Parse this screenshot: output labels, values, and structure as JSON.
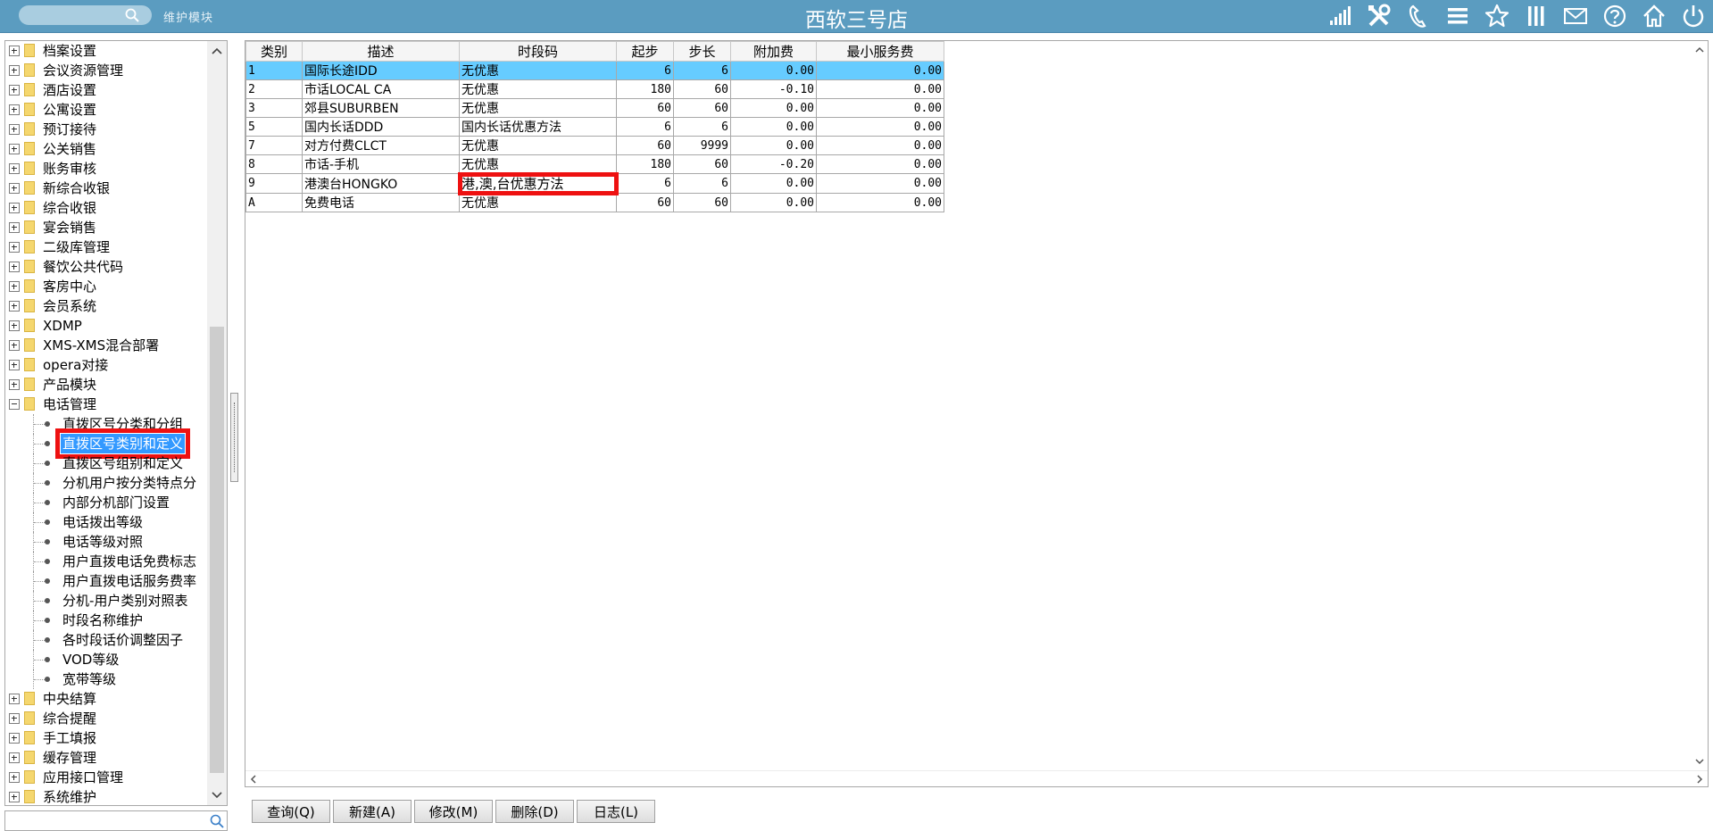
{
  "header": {
    "module_label": "维护模块",
    "title": "西软三号店",
    "toolbar_icons": [
      "signal-icon",
      "tools-icon",
      "phone-icon",
      "menu-icon",
      "star-icon",
      "columns-icon",
      "mail-icon",
      "help-icon",
      "home-icon",
      "power-icon"
    ]
  },
  "tree": {
    "top_items": [
      "档案设置",
      "会议资源管理",
      "酒店设置",
      "公寓设置",
      "预订接待",
      "公关销售",
      "账务审核",
      "新综合收银",
      "综合收银",
      "宴会销售",
      "二级库管理",
      "餐饮公共代码",
      "客房中心",
      "会员系统",
      "XDMP",
      "XMS-XMS混合部署",
      "opera对接",
      "产品模块"
    ],
    "expanded_item": "电话管理",
    "children": [
      "直拨区号分类和分组",
      "直拨区号类别和定义",
      "直拨区号组别和定义",
      "分机用户按分类特点分",
      "内部分机部门设置",
      "电话拨出等级",
      "电话等级对照",
      "用户直拨电话免费标志",
      "用户直拨电话服务费率",
      "分机-用户类别对照表",
      "时段名称维护",
      "各时段话价调整因子",
      "VOD等级",
      "宽带等级"
    ],
    "selected_child_index": 1,
    "bottom_items": [
      "中央结算",
      "综合提醒",
      "手工填报",
      "缓存管理",
      "应用接口管理",
      "系统维护"
    ]
  },
  "grid": {
    "columns": [
      "类别",
      "描述",
      "时段码",
      "起步",
      "步长",
      "附加费",
      "最小服务费"
    ],
    "rows": [
      [
        "1",
        "国际长途IDD",
        "无优惠",
        "6",
        "6",
        "0.00",
        "0.00"
      ],
      [
        "2",
        "市话LOCAL CA",
        "无优惠",
        "180",
        "60",
        "-0.10",
        "0.00"
      ],
      [
        "3",
        "郊县SUBURBEN",
        "无优惠",
        "60",
        "60",
        "0.00",
        "0.00"
      ],
      [
        "5",
        "国内长话DDD",
        "国内长话优惠方法",
        "6",
        "6",
        "0.00",
        "0.00"
      ],
      [
        "7",
        "对方付费CLCT",
        "无优惠",
        "60",
        "9999",
        "0.00",
        "0.00"
      ],
      [
        "8",
        "市话-手机",
        "无优惠",
        "180",
        "60",
        "-0.20",
        "0.00"
      ],
      [
        "9",
        "港澳台HONGKO",
        "港,澳,台优惠方法",
        "6",
        "6",
        "0.00",
        "0.00"
      ],
      [
        "A",
        "免费电话",
        "无优惠",
        "60",
        "60",
        "0.00",
        "0.00"
      ]
    ],
    "active_row_index": 0,
    "highlight_cell": {
      "row": 6,
      "col": 2
    }
  },
  "buttons": {
    "query": "查询(Q)",
    "new": "新建(A)",
    "modify": "修改(M)",
    "delete": "删除(D)",
    "log": "日志(L)"
  },
  "colors": {
    "header_bg": "#5b9cc0",
    "active_row": "#66ccff",
    "selection": "#3399ff",
    "highlight_border": "#ee1111"
  }
}
